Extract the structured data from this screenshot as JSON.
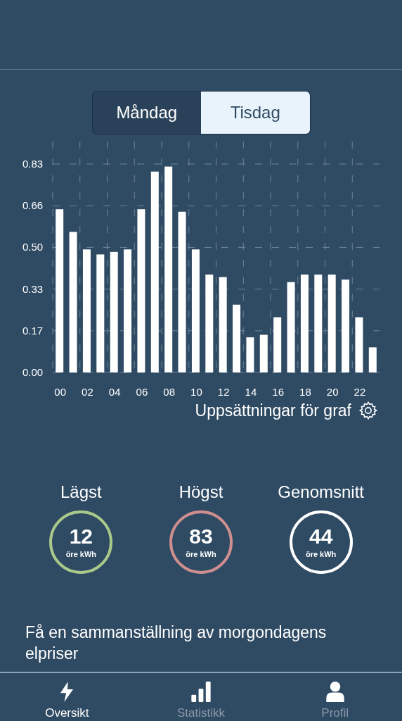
{
  "day_tabs": [
    {
      "label": "Måndag",
      "selected": false
    },
    {
      "label": "Tisdag",
      "selected": true
    }
  ],
  "chart_data": {
    "type": "bar",
    "grid": true,
    "x": [
      0,
      1,
      2,
      3,
      4,
      5,
      6,
      7,
      8,
      9,
      10,
      11,
      12,
      13,
      14,
      15,
      16,
      17,
      18,
      19,
      20,
      21,
      22,
      23
    ],
    "xlim": [
      -0.5,
      23.5
    ],
    "series": [
      {
        "color": "#ffffff",
        "values": [
          0.65,
          0.56,
          0.49,
          0.47,
          0.48,
          0.49,
          0.65,
          0.8,
          0.82,
          0.64,
          0.49,
          0.39,
          0.38,
          0.27,
          0.14,
          0.15,
          0.22,
          0.36,
          0.39,
          0.39,
          0.39,
          0.37,
          0.22,
          0.1
        ]
      }
    ],
    "ylim": [
      0,
      0.83
    ],
    "yticks": [
      {
        "value": 0,
        "label": "0.00"
      },
      {
        "value": 0.166,
        "label": "0.17"
      },
      {
        "value": 0.332,
        "label": "0.33"
      },
      {
        "value": 0.498,
        "label": "0.50"
      },
      {
        "value": 0.664,
        "label": "0.66"
      },
      {
        "value": 0.83,
        "label": "0.83"
      }
    ],
    "xticks": [
      {
        "value": 0,
        "label": "00"
      },
      {
        "value": 2,
        "label": "02"
      },
      {
        "value": 4,
        "label": "04"
      },
      {
        "value": 6,
        "label": "06"
      },
      {
        "value": 8,
        "label": "08"
      },
      {
        "value": 10,
        "label": "10"
      },
      {
        "value": 12,
        "label": "12"
      },
      {
        "value": 14,
        "label": "14"
      },
      {
        "value": 16,
        "label": "16"
      },
      {
        "value": 18,
        "label": "18"
      },
      {
        "value": 20,
        "label": "20"
      },
      {
        "value": 22,
        "label": "22"
      }
    ]
  },
  "chart_settings": "Uppsättningar för graf",
  "stats": [
    {
      "title": "Lägst",
      "value": "12",
      "unit": "öre kWh",
      "color": "#a9c98a"
    },
    {
      "title": "Högst",
      "value": "83",
      "unit": "öre kWh",
      "color": "#d08f8f"
    },
    {
      "title": "Genomsnitt",
      "value": "44",
      "unit": "öre kWh",
      "color": "#ffffff"
    }
  ],
  "summary_text": "Få en sammanställning av morgondagens elpriser",
  "tab_bar": [
    {
      "label": "Oversikt",
      "kind": "overview",
      "selected": true
    },
    {
      "label": "Statistikk",
      "kind": "statistics",
      "selected": false
    },
    {
      "label": "Profil",
      "kind": "profile",
      "selected": false
    }
  ]
}
